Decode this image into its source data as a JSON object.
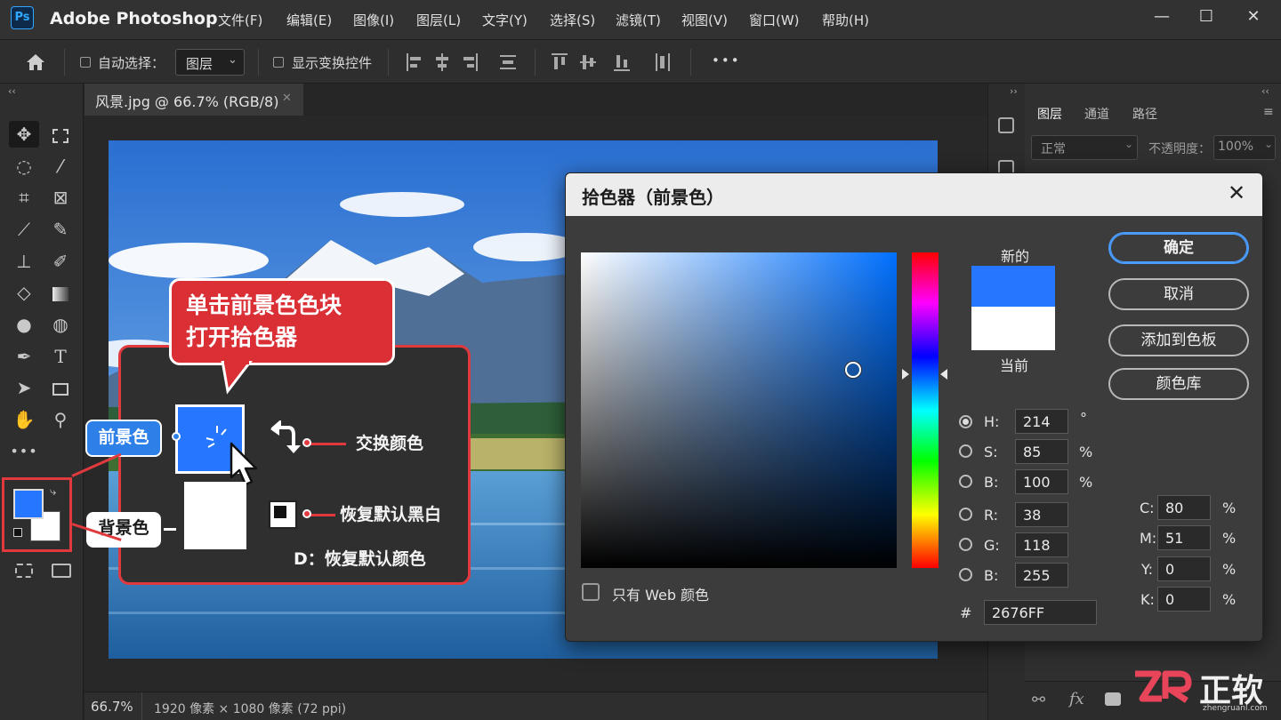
{
  "app": {
    "logo": "Ps",
    "title": "Adobe Photoshop"
  },
  "menu": [
    "文件(F)",
    "编辑(E)",
    "图像(I)",
    "图层(L)",
    "文字(Y)",
    "选择(S)",
    "滤镜(T)",
    "视图(V)",
    "窗口(W)",
    "帮助(H)"
  ],
  "window_controls": {
    "minimize": "—",
    "maximize": "☐",
    "close": "✕"
  },
  "options": {
    "auto_select_label": "自动选择：",
    "auto_select_value": "图层",
    "show_transform_label": "显示变换控件",
    "more": "•••"
  },
  "document": {
    "tab_title": "风景.jpg @ 66.7% (RGB/8)",
    "tab_close": "✕"
  },
  "status": {
    "zoom": "66.7%",
    "dimensions": "1920 像素 × 1080 像素 (72 ppi)"
  },
  "panels": {
    "tabs": [
      "图层",
      "通道",
      "路径"
    ],
    "blend_mode": "正常",
    "opacity_label": "不透明度：",
    "opacity_value": "100%"
  },
  "callout": {
    "bubble_line1": "单击前景色色块",
    "bubble_line2": "打开拾色器",
    "foreground_label": "前景色",
    "background_label": "背景色",
    "swap_label": "交换颜色",
    "reset_label": "恢复默认黑白",
    "shortcut_label": "D：恢复默认颜色"
  },
  "picker": {
    "title": "拾色器（前景色）",
    "close": "✕",
    "new_label": "新的",
    "current_label": "当前",
    "buttons": {
      "ok": "确定",
      "cancel": "取消",
      "add_swatch": "添加到色板",
      "libraries": "颜色库"
    },
    "web_only_label": "只有 Web 颜色",
    "hsb": {
      "h": "214",
      "s": "85",
      "b": "100"
    },
    "rgb": {
      "r": "38",
      "g": "118",
      "b": "255"
    },
    "cmyk": {
      "c": "80",
      "m": "51",
      "y": "0",
      "k": "0"
    },
    "hex": "2676FF",
    "labels": {
      "h": "H:",
      "s": "S:",
      "b": "B:",
      "r": "R:",
      "g": "G:",
      "b2": "B:",
      "c": "C:",
      "m": "M:",
      "y": "Y:",
      "k": "K:",
      "hash": "#"
    },
    "units": {
      "degree": "°",
      "percent": "%"
    }
  },
  "colors": {
    "foreground": "#2676FF",
    "current": "#FFFFFF",
    "accent_red": "#E0393E"
  },
  "watermark": {
    "text": "正软",
    "site": "zhengruanl.com"
  }
}
